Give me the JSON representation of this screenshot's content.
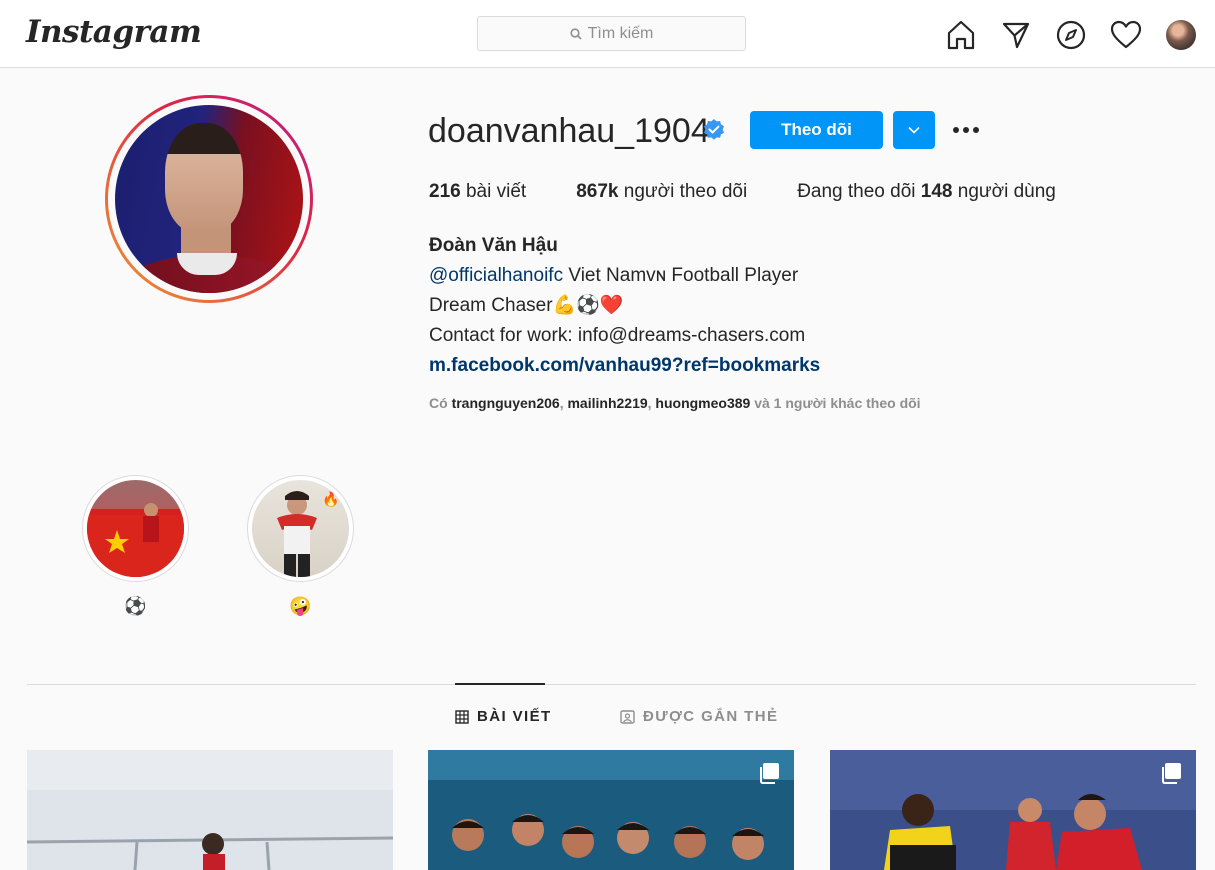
{
  "nav": {
    "logo_text": "Instagram",
    "search_placeholder": "Tìm kiếm",
    "icons": [
      "home-icon",
      "direct-message-icon",
      "explore-icon",
      "activity-heart-icon",
      "profile-avatar"
    ]
  },
  "profile": {
    "username": "doanvanhau_1904",
    "verified": true,
    "follow_label": "Theo dõi",
    "stats": {
      "posts_count": "216",
      "posts_label": "bài viết",
      "followers_count": "867k",
      "followers_label": "người theo dõi",
      "following_prefix": "Đang theo dõi",
      "following_count": "148",
      "following_suffix": "người dùng"
    },
    "bio": {
      "full_name": "Đoàn Văn Hậu",
      "mention": "@officialhanoifc",
      "line1_rest": "Viet Namᴠɴ Football Player",
      "line2": "Dream Chaser💪⚽❤️",
      "line3": "Contact for work: info@dreams-chasers.com",
      "website": "m.facebook.com/vanhau99?ref=bookmarks"
    },
    "followed_by": {
      "prefix": "Có",
      "users": [
        "trangnguyen206",
        "mailinh2219",
        "huongmeo389"
      ],
      "suffix": "và 1 người khác theo dõi"
    }
  },
  "highlights": [
    {
      "label": "⚽"
    },
    {
      "label": "🤪"
    }
  ],
  "tabs": [
    {
      "label": "BÀI VIẾT",
      "active": true
    },
    {
      "label": "ĐƯỢC GẮN THẺ",
      "active": false
    }
  ],
  "colors": {
    "accent": "#0095f6",
    "link": "#00376b",
    "muted": "#8e8e8e",
    "border": "#dbdbdb"
  }
}
